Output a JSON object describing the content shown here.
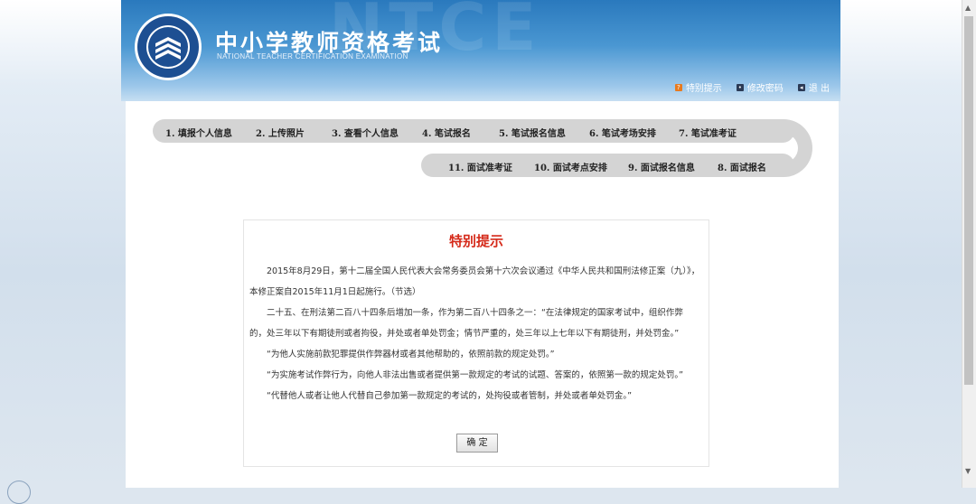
{
  "header": {
    "title": "中小学教师资格考试",
    "subtitle": "NATIONAL TEACHER CERTIFICATION EXAMINATION",
    "watermark": "NTCE",
    "logo_icon": "book-emblem-icon",
    "links": [
      {
        "label": "特别提示",
        "icon": "notice-icon"
      },
      {
        "label": "修改密码",
        "icon": "password-icon"
      },
      {
        "label": "退 出",
        "icon": "logout-icon"
      }
    ]
  },
  "steps_row1": [
    "1. 填报个人信息",
    "2. 上传照片",
    "3. 查看个人信息",
    "4. 笔试报名",
    "5. 笔试报名信息",
    "6. 笔试考场安排",
    "7. 笔试准考证"
  ],
  "steps_row2": [
    "11. 面试准考证",
    "10. 面试考点安排",
    "9. 面试报名信息",
    "8. 面试报名"
  ],
  "notice": {
    "title": "特别提示",
    "paragraphs": [
      "2015年8月29日，第十二届全国人民代表大会常务委员会第十六次会议通过《中华人民共和国刑法修正案（九）》，",
      "本修正案自2015年11月1日起施行。（节选）",
      "二十五、在刑法第二百八十四条后增加一条，作为第二百八十四条之一：“在法律规定的国家考试中，组织作弊",
      "的，处三年以下有期徒刑或者拘役，并处或者单处罚金；情节严重的，处三年以上七年以下有期徒刑，并处罚金。”",
      "“为他人实施前款犯罪提供作弊器材或者其他帮助的，依照前款的规定处罚。”",
      "“为实施考试作弊行为，向他人非法出售或者提供第一款规定的考试的试题、答案的，依照第一款的规定处罚。”",
      "“代替他人或者让他人代替自己参加第一款规定的考试的，处拘役或者管制，并处或者单处罚金。”"
    ],
    "confirm_label": "确 定"
  },
  "colors": {
    "header_blue": "#2a79bd",
    "title_red": "#d52a1a",
    "nav_gray": "#d4d4d4"
  }
}
